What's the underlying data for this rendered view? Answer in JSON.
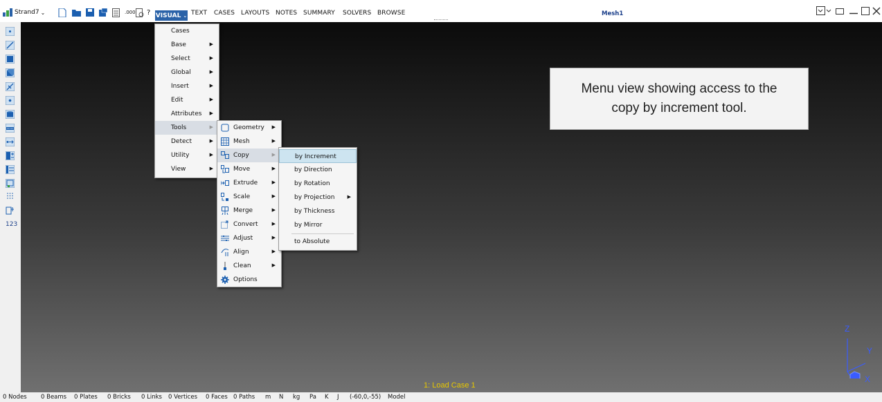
{
  "app": {
    "name": "Strand7",
    "doc_title": "Mesh1"
  },
  "menubar": [
    {
      "label": "VISUAL",
      "active": true
    },
    {
      "label": "TEXT"
    },
    {
      "label": "CASES"
    },
    {
      "label": "LAYOUTS"
    },
    {
      "label": "NOTES"
    },
    {
      "label": "SUMMARY"
    },
    {
      "label": "SOLVERS"
    },
    {
      "label": "BROWSE"
    }
  ],
  "quick_toolbar": {
    "decimals_label": ".000",
    "help_label": "?"
  },
  "visual_menu": [
    {
      "label": "Cases"
    },
    {
      "label": "Base",
      "submenu": true
    },
    {
      "label": "Select",
      "submenu": true
    },
    {
      "label": "Global",
      "submenu": true
    },
    {
      "label": "Insert",
      "submenu": true
    },
    {
      "label": "Edit",
      "submenu": true
    },
    {
      "label": "Attributes",
      "submenu": true
    },
    {
      "label": "Tools",
      "submenu": true,
      "highlighted": true
    },
    {
      "label": "Detect",
      "submenu": true
    },
    {
      "label": "Utility",
      "submenu": true
    },
    {
      "label": "View",
      "submenu": true
    }
  ],
  "tools_menu": [
    {
      "label": "Geometry",
      "icon": "geometry-icon",
      "submenu": true
    },
    {
      "label": "Mesh",
      "icon": "mesh-icon",
      "submenu": true
    },
    {
      "label": "Copy",
      "icon": "copy-icon",
      "submenu": true,
      "highlighted": true
    },
    {
      "label": "Move",
      "icon": "move-icon",
      "submenu": true
    },
    {
      "label": "Extrude",
      "icon": "extrude-icon",
      "submenu": true
    },
    {
      "label": "Scale",
      "icon": "scale-icon",
      "submenu": true
    },
    {
      "label": "Merge",
      "icon": "merge-icon",
      "submenu": true
    },
    {
      "label": "Convert",
      "icon": "convert-icon",
      "submenu": true
    },
    {
      "label": "Adjust",
      "icon": "adjust-icon",
      "submenu": true
    },
    {
      "label": "Align",
      "icon": "align-icon",
      "submenu": true
    },
    {
      "label": "Clean",
      "icon": "clean-icon",
      "submenu": true
    },
    {
      "label": "Options",
      "icon": "gear-icon"
    }
  ],
  "copy_menu": [
    {
      "label": "by Increment",
      "selected": true
    },
    {
      "label": "by Direction"
    },
    {
      "label": "by Rotation"
    },
    {
      "label": "by Projection",
      "submenu": true
    },
    {
      "label": "by Thickness"
    },
    {
      "label": "by Mirror"
    },
    {
      "label": "to Absolute"
    }
  ],
  "caption": "Menu view showing access to the copy by increment tool.",
  "viewport": {
    "load_case": "1: Load Case 1",
    "axes": {
      "z": "Z",
      "y": "Y",
      "x": "X"
    }
  },
  "statusbar": [
    "0 Nodes",
    "0 Beams",
    "0 Plates",
    "0 Bricks",
    "0 Links",
    "0 Vertices",
    "0 Faces",
    "0 Paths",
    "m",
    "N",
    "kg",
    "Pa",
    "K",
    "J",
    "(-60,0,-55)",
    "Model"
  ],
  "left_toolbar": {
    "icons": [
      "node-icon",
      "beam-icon",
      "plate-icon",
      "brick-icon",
      "link-icon",
      "vertex-icon",
      "face-icon",
      "path-icon",
      "load-path-icon",
      "attributes-icon",
      "combo-icon",
      "results-icon",
      "grid-icon",
      "entity-icon",
      "numbering-icon"
    ],
    "numbering_label": "123"
  },
  "colors": {
    "menu_active": "#2a62a8",
    "highlight": "#cde4f0",
    "loadcase_text": "#e8c800",
    "axis": "#3a5cff"
  }
}
